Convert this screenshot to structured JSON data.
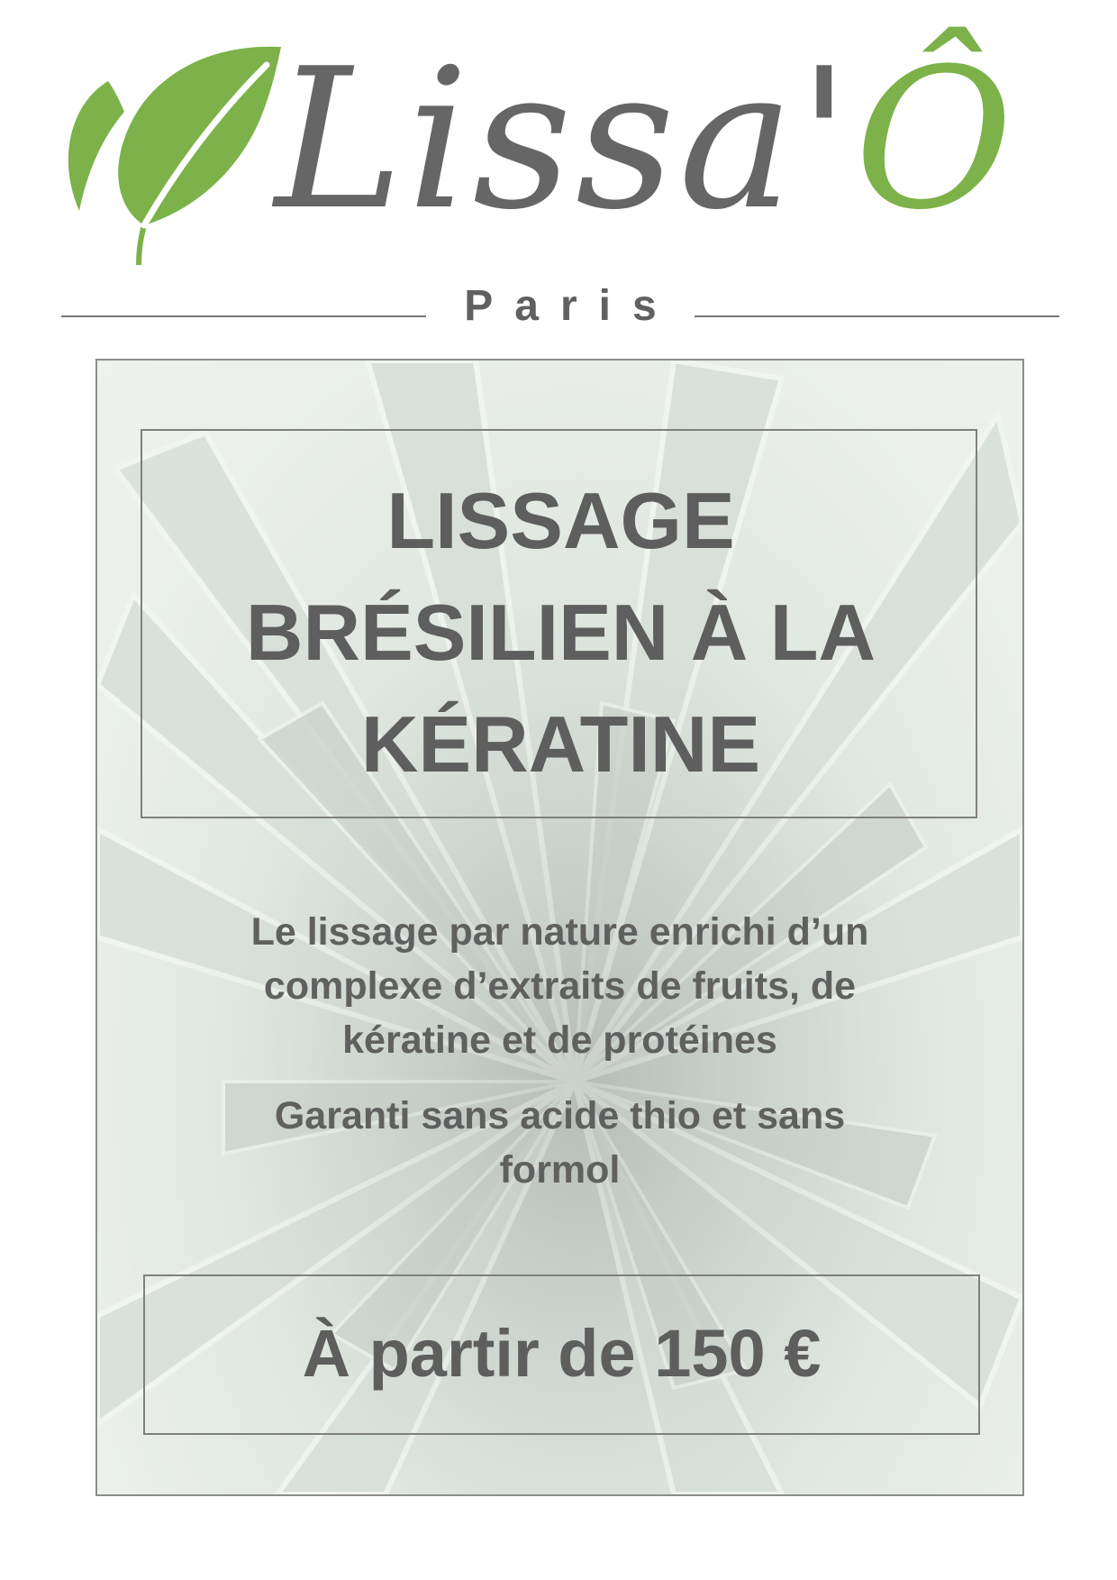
{
  "brand": {
    "name_main": "Lissa'",
    "name_accent": "Ô",
    "city": "Paris",
    "colors": {
      "green": "#7cb249",
      "grey": "#656665"
    },
    "logo_icon": "leaf-icon"
  },
  "poster": {
    "title_lines": [
      "LISSAGE",
      "BRÉSILIEN À LA",
      "KÉRATINE"
    ],
    "description_lines": [
      "Le lissage par nature enrichi d’un",
      "complexe d’extraits de fruits, de",
      "kératine et de protéines"
    ],
    "guarantee_lines": [
      "Garanti sans acide thio et sans",
      "formol"
    ],
    "price": "À partir de 150 €",
    "background_icon": "aloe-plant-icon"
  }
}
